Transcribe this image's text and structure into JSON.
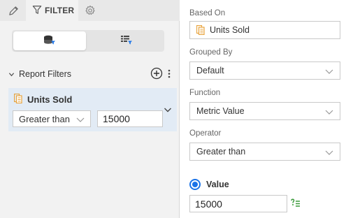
{
  "tabs": {
    "edit_icon": "pencil-icon",
    "filter_label": "FILTER",
    "settings_icon": "gear-icon"
  },
  "toggle": {
    "options": [
      "database-filter-icon",
      "table-filter-icon"
    ],
    "selected": 0
  },
  "report_filters": {
    "title": "Report Filters",
    "filters": [
      {
        "name": "Units Sold",
        "operator": "Greater than",
        "value": "15000"
      }
    ]
  },
  "properties": {
    "based_on": {
      "label": "Based On",
      "value": "Units Sold"
    },
    "grouped_by": {
      "label": "Grouped By",
      "value": "Default"
    },
    "function": {
      "label": "Function",
      "value": "Metric Value"
    },
    "operator": {
      "label": "Operator",
      "value": "Greater than"
    },
    "value_mode": {
      "label": "Value",
      "selected": true
    },
    "value": "15000"
  },
  "colors": {
    "accent": "#1a73e8",
    "metric_icon": "#e8a33c",
    "card_bg": "#e2ebf5",
    "expression_icon": "#3a9a3a"
  }
}
